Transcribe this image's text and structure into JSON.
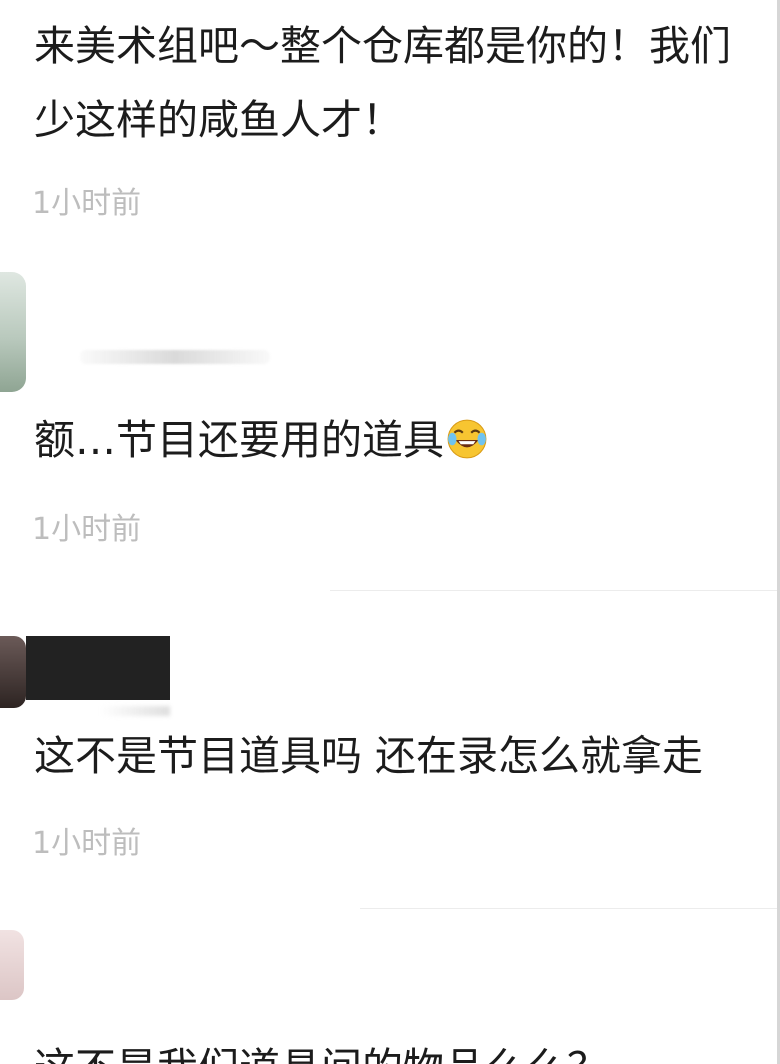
{
  "comments": [
    {
      "text_line1": "来美术组吧～整个仓库都是你的！我们",
      "text_line2": "少这样的咸鱼人才！",
      "time": "1小时前"
    },
    {
      "text": "额…节目还要用的道具",
      "emoji": "face-with-tears-of-joy-icon",
      "time": "1小时前"
    },
    {
      "text": "这不是节目道具吗 还在录怎么就拿走",
      "time": "1小时前"
    },
    {
      "text": "这不是我们道具间的物品么么？"
    }
  ]
}
